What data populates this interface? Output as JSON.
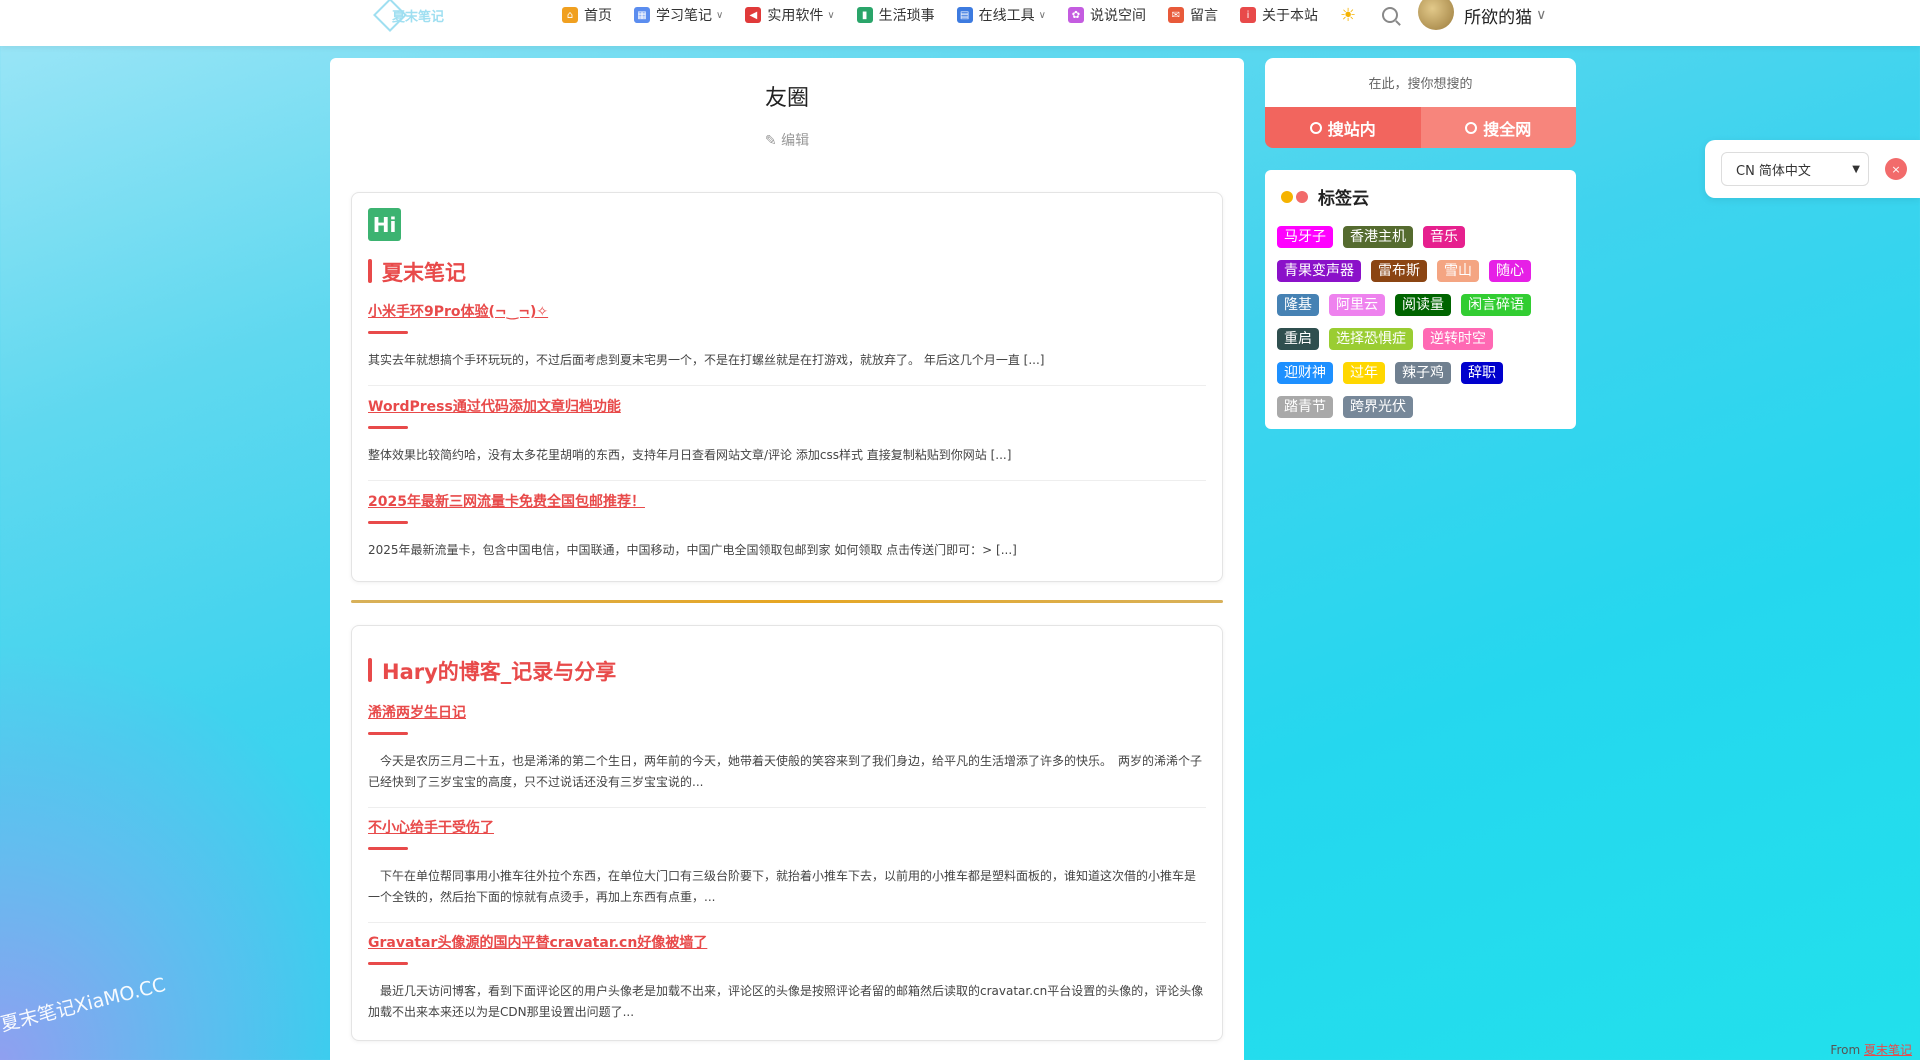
{
  "nav": {
    "logo_text": "夏末笔记",
    "items": [
      {
        "label": "首页",
        "icon": "home-icon",
        "color": "#f0a020",
        "dropdown": false
      },
      {
        "label": "学习笔记",
        "icon": "grid-icon",
        "color": "#5b8def",
        "dropdown": true
      },
      {
        "label": "实用软件",
        "icon": "share-icon",
        "color": "#e03a3a",
        "dropdown": true
      },
      {
        "label": "生活琐事",
        "icon": "chart-icon",
        "color": "#2aa56a",
        "dropdown": false
      },
      {
        "label": "在线工具",
        "icon": "tool-icon",
        "color": "#3d7be0",
        "dropdown": true
      },
      {
        "label": "说说空间",
        "icon": "flower-icon",
        "color": "#c45ce0",
        "dropdown": false
      },
      {
        "label": "留言",
        "icon": "message-icon",
        "color": "#e85a3a",
        "dropdown": false
      },
      {
        "label": "关于本站",
        "icon": "info-icon",
        "color": "#e84a4a",
        "dropdown": false
      }
    ],
    "user_name": "所欲的猫"
  },
  "page": {
    "title": "友圈",
    "edit_label": "编辑"
  },
  "cards": [
    {
      "badge": "Hi",
      "site_title": "夏末笔记",
      "posts": [
        {
          "title": "小米手环9Pro体验(¬‿¬)✧",
          "excerpt": "其实去年就想搞个手环玩玩的，不过后面考虑到夏末宅男一个，不是在打螺丝就是在打游戏，就放弃了。 年后这几个月一直 [...]"
        },
        {
          "title": "WordPress通过代码添加文章归档功能",
          "excerpt": "整体效果比较简约哈，没有太多花里胡哨的东西，支持年月日查看网站文章/评论 添加css样式 直接复制粘贴到你网站 [...]"
        },
        {
          "title": "2025年最新三网流量卡免费全国包邮推荐！",
          "excerpt": "2025年最新流量卡，包含中国电信，中国联通，中国移动，中国广电全国领取包邮到家 如何领取 点击传送门即可：> [...]"
        }
      ]
    },
    {
      "site_title": "Hary的博客_记录与分享",
      "posts": [
        {
          "title": "浠浠两岁生日记",
          "excerpt": "　今天是农历三月二十五，也是浠浠的第二个生日，两年前的今天，她带着天使般的笑容来到了我们身边，给平凡的生活增添了许多的快乐。　两岁的浠浠个子已经快到了三岁宝宝的高度，只不过说话还没有三岁宝宝说的..."
        },
        {
          "title": "不小心给手干受伤了",
          "excerpt": "　下午在单位帮同事用小推车往外拉个东西，在单位大门口有三级台阶要下，就抬着小推车下去，以前用的小推车都是塑料面板的，谁知道这次借的小推车是一个全铁的，然后抬下面的惊就有点烫手，再加上东西有点重，..."
        },
        {
          "title": "Gravatar头像源的国内平替cravatar.cn好像被墙了",
          "excerpt": "　最近几天访问博客，看到下面评论区的用户头像老是加载不出来，评论区的头像是按照评论者留的邮箱然后读取的cravatar.cn平台设置的头像的，评论头像加载不出来本来还以为是CDN那里设置出问题了..."
        }
      ]
    }
  ],
  "search": {
    "placeholder": "在此，搜你想搜的",
    "site_button": "搜站内",
    "web_button": "搜全网"
  },
  "tag_cloud": {
    "title": "标签云",
    "dot_colors": [
      "#f5b300",
      "#f26b6b"
    ],
    "tags": [
      {
        "label": "马牙子",
        "color": "#ff00ff"
      },
      {
        "label": "香港主机",
        "color": "#556b2f"
      },
      {
        "label": "音乐",
        "color": "#e6208e"
      },
      {
        "label": "青果变声器",
        "color": "#8b11c9"
      },
      {
        "label": "雷布斯",
        "color": "#8b4513"
      },
      {
        "label": "雪山",
        "color": "#f4a582"
      },
      {
        "label": "随心",
        "color": "#e620e6"
      },
      {
        "label": "隆基",
        "color": "#4682b4"
      },
      {
        "label": "阿里云",
        "color": "#ee82ee"
      },
      {
        "label": "阅读量",
        "color": "#006400"
      },
      {
        "label": "闲言碎语",
        "color": "#32cd32"
      },
      {
        "label": "重启",
        "color": "#2f4f4f"
      },
      {
        "label": "选择恐惧症",
        "color": "#9acd32"
      },
      {
        "label": "逆转时空",
        "color": "#ff69b4"
      },
      {
        "label": "迎财神",
        "color": "#1e90ff"
      },
      {
        "label": "过年",
        "color": "#ffd700"
      },
      {
        "label": "辣子鸡",
        "color": "#708090"
      },
      {
        "label": "辞职",
        "color": "#0000cd"
      },
      {
        "label": "踏青节",
        "color": "#a9a9a9"
      },
      {
        "label": "跨界光伏",
        "color": "#778899"
      }
    ]
  },
  "language": {
    "selected": "CN 简体中文",
    "close_label": "×"
  },
  "watermark": "夏末笔记XiaMO.CC",
  "footer": {
    "from_label": "From",
    "from_link": "夏末笔记"
  }
}
